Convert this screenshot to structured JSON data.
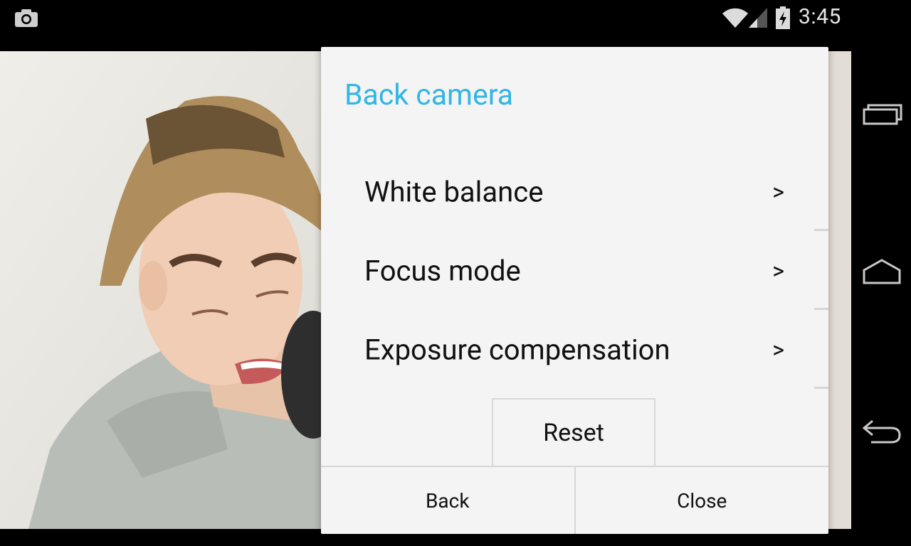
{
  "status_bar": {
    "time": "3:45",
    "icons": [
      "camera-icon",
      "wifi-icon",
      "signal-icon",
      "battery-charging-icon"
    ]
  },
  "dialog": {
    "title": "Back camera",
    "items": [
      {
        "label": "White balance",
        "chevron": ">"
      },
      {
        "label": "Focus mode",
        "chevron": ">"
      },
      {
        "label": "Exposure compensation",
        "chevron": ">"
      }
    ],
    "reset_label": "Reset",
    "back_label": "Back",
    "close_label": "Close"
  },
  "nav_bar": {
    "icons": [
      "recent-apps-icon",
      "home-icon",
      "back-icon"
    ]
  },
  "colors": {
    "accent": "#33b5e5",
    "dialog_bg": "#f4f4f4",
    "bar_bg": "#000000"
  }
}
